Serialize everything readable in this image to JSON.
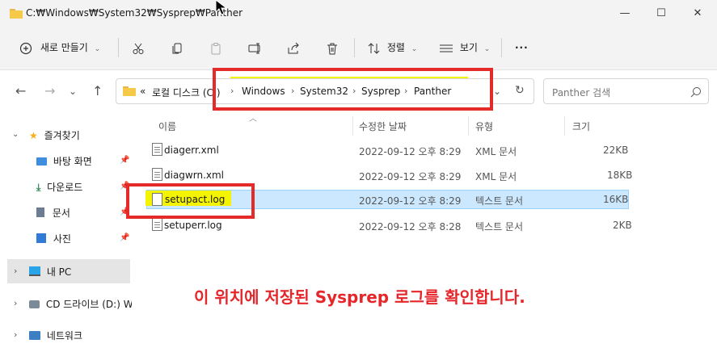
{
  "window": {
    "title": "C:₩Windows₩System32₩Sysprep₩Panther",
    "minimize_glyph": "—",
    "maximize_glyph": "☐",
    "close_glyph": "✕"
  },
  "toolbar": {
    "new_label": "새로 만들기",
    "sort_label": "정렬",
    "view_label": "보기",
    "more_glyph": "···"
  },
  "address": {
    "prefix": "«",
    "crumbs": [
      "로컬 디스크 (C:)",
      "Windows",
      "System32",
      "Sysprep",
      "Panther"
    ],
    "search_placeholder": "Panther 검색"
  },
  "sidebar": {
    "items": [
      {
        "label": "즐겨찾기",
        "icon": "star-icon"
      },
      {
        "label": "바탕 화면",
        "icon": "desktop-icon"
      },
      {
        "label": "다운로드",
        "icon": "download-icon"
      },
      {
        "label": "문서",
        "icon": "document-icon"
      },
      {
        "label": "사진",
        "icon": "picture-icon"
      },
      {
        "label": "내 PC",
        "icon": "pc-icon"
      },
      {
        "label": "CD 드라이브 (D:) W",
        "icon": "cd-drive-icon"
      },
      {
        "label": "네트워크",
        "icon": "network-icon"
      }
    ]
  },
  "columns": {
    "name": "이름",
    "date": "수정한 날짜",
    "type": "유형",
    "size": "크기"
  },
  "files": [
    {
      "name": "diagerr.xml",
      "date": "2022-09-12 오후 8:29",
      "type": "XML 문서",
      "size": "22KB"
    },
    {
      "name": "diagwrn.xml",
      "date": "2022-09-12 오후 8:29",
      "type": "XML 문서",
      "size": "18KB"
    },
    {
      "name": "setupact.log",
      "date": "2022-09-12 오후 8:29",
      "type": "텍스트 문서",
      "size": "16KB"
    },
    {
      "name": "setuperr.log",
      "date": "2022-09-12 오후 8:28",
      "type": "텍스트 문서",
      "size": "2KB"
    }
  ],
  "annotation": "이 위치에 저장된 Sysprep 로그를 확인합니다.",
  "colors": {
    "annotation_red": "#e5262a",
    "highlight_yellow": "#f4f400",
    "selection_blue": "#cce8ff"
  }
}
